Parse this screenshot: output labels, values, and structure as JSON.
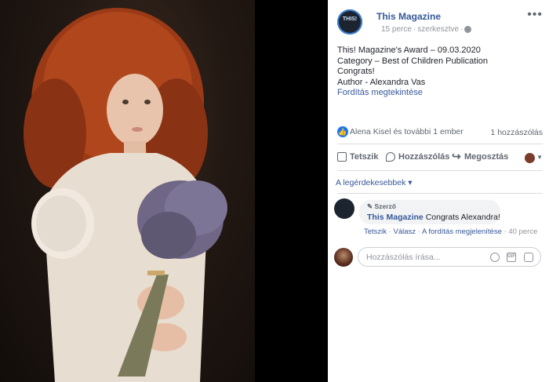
{
  "post": {
    "page_name": "This Magazine",
    "avatar_text": "THIS!",
    "time": "15 perce",
    "edited": "szerkesztve",
    "text_lines": [
      "This! Magazine's Award – 09.03.2020",
      "Category – Best of Children Publication",
      "Congrats!",
      "Author - Alexandra Vas"
    ],
    "see_translation": "Fordítás megtekintése"
  },
  "reactions": {
    "names": "Alena Kisel és további 1 ember",
    "comment_count": "1 hozzászólás"
  },
  "actions": {
    "like": "Tetszik",
    "comment": "Hozzászólás",
    "share": "Megosztás"
  },
  "sort": {
    "label": "A legérdekesebbek ▾"
  },
  "comment": {
    "badge": "Szerző",
    "author": "This Magazine",
    "text": "Congrats Alexandra!",
    "like": "Tetszik",
    "reply": "Válasz",
    "see_translation": "A fordítás megjelenítése",
    "time": "40 perce"
  },
  "reply_box": {
    "placeholder": "Hozzászólás írása..."
  },
  "colors": {
    "link": "#385898",
    "accent": "#1877f2",
    "background": "#000000"
  }
}
